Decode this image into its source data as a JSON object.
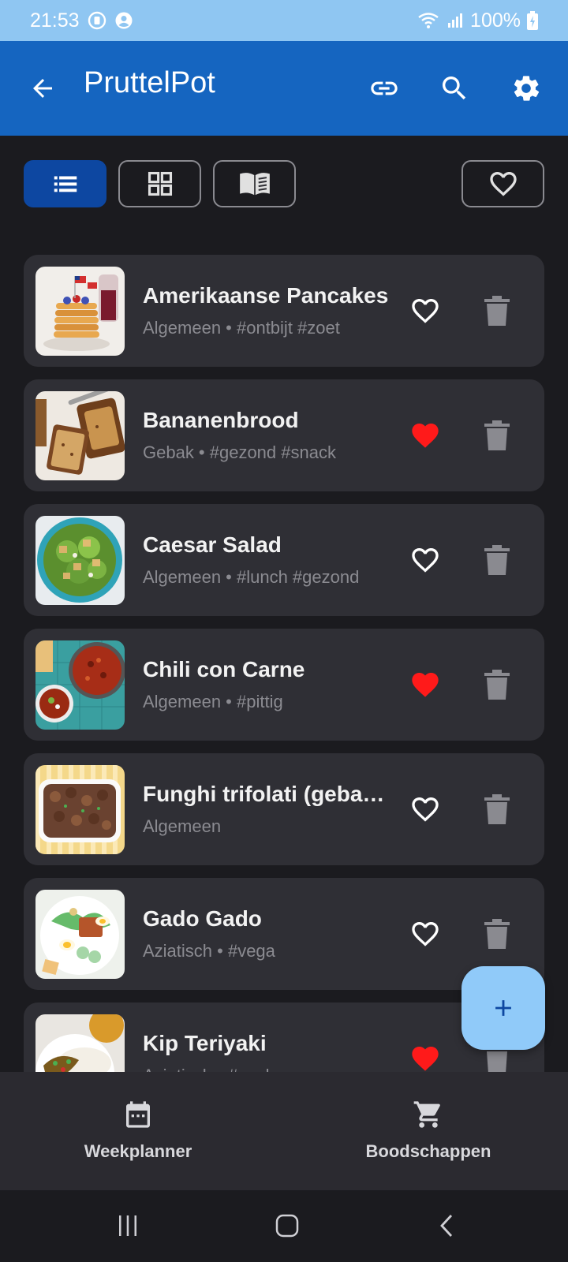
{
  "status_bar": {
    "time": "21:53",
    "battery": "100%"
  },
  "app_bar": {
    "title": "PruttelPot"
  },
  "view_toggles": [
    "list",
    "grid",
    "book"
  ],
  "recipes": [
    {
      "title": "Amerikaanse Pancakes",
      "subtitle": "Algemeen • #ontbijt #zoet",
      "favorite": false,
      "thumb": "pancakes-image"
    },
    {
      "title": "Bananenbrood",
      "subtitle": "Gebak • #gezond #snack",
      "favorite": true,
      "thumb": "banana-bread-image"
    },
    {
      "title": "Caesar Salad",
      "subtitle": "Algemeen • #lunch #gezond",
      "favorite": false,
      "thumb": "caesar-salad-image"
    },
    {
      "title": "Chili con Carne",
      "subtitle": "Algemeen • #pittig",
      "favorite": true,
      "thumb": "chili-image"
    },
    {
      "title": "Funghi trifolati (gebakken champignons)",
      "subtitle": "Algemeen",
      "favorite": false,
      "thumb": "funghi-image"
    },
    {
      "title": "Gado Gado",
      "subtitle": "Aziatisch • #vega",
      "favorite": false,
      "thumb": "gado-gado-image"
    },
    {
      "title": "Kip Teriyaki",
      "subtitle": "Aziatisch • #snel",
      "favorite": true,
      "thumb": "teriyaki-image"
    }
  ],
  "bottom_nav": {
    "weekplanner": "Weekplanner",
    "boodschappen": "Boodschappen"
  },
  "colors": {
    "app_bar": "#1565c0",
    "status_bar": "#8fc6f2",
    "heart_active": "#ff1a1a",
    "fab": "#90caf9",
    "card": "#2f2f35"
  }
}
